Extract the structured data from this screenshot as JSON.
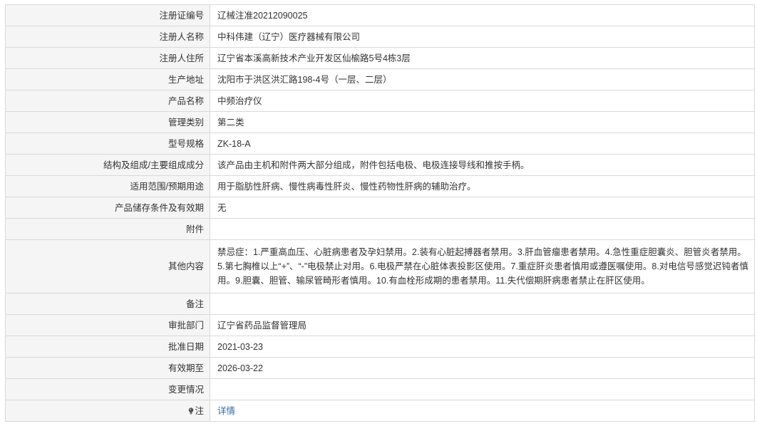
{
  "rows": [
    {
      "label": "注册证编号",
      "value": "辽械注准20212090025"
    },
    {
      "label": "注册人名称",
      "value": "中科伟建（辽宁）医疗器械有限公司"
    },
    {
      "label": "注册人住所",
      "value": "辽宁省本溪高新技术产业开发区仙榆路5号4栋3层"
    },
    {
      "label": "生产地址",
      "value": "沈阳市于洪区洪汇路198-4号（一层、二层）"
    },
    {
      "label": "产品名称",
      "value": "中频治疗仪"
    },
    {
      "label": "管理类别",
      "value": "第二类"
    },
    {
      "label": "型号规格",
      "value": "ZK-18-A"
    },
    {
      "label": "结构及组成/主要组成成分",
      "value": "该产品由主机和附件两大部分组成，附件包括电极、电极连接导线和推按手柄。"
    },
    {
      "label": "适用范围/预期用途",
      "value": "用于脂肪性肝病、慢性病毒性肝炎、慢性药物性肝病的辅助治疗。"
    },
    {
      "label": "产品储存条件及有效期",
      "value": "无"
    },
    {
      "label": "附件",
      "value": ""
    },
    {
      "label": "其他内容",
      "value": "禁忌症：1.严重高血压、心脏病患者及孕妇禁用。2.装有心脏起搏器者禁用。3.肝血管瘤患者禁用。4.急性重症胆囊炎、胆管炎者禁用。5.第七胸椎以上“+”、“-”电极禁止对用。6.电极严禁在心脏体表投影区使用。7.重症肝炎患者慎用或遵医嘱使用。8.对电信号感觉迟钝者慎用。9.胆囊、胆管、输尿管畸形者慎用。10.有血栓形成期的患者禁用。11.失代偿期肝病患者禁止在肝区使用。"
    },
    {
      "label": "备注",
      "value": ""
    },
    {
      "label": "审批部门",
      "value": "辽宁省药品监督管理局"
    },
    {
      "label": "批准日期",
      "value": "2021-03-23"
    },
    {
      "label": "有效期至",
      "value": "2026-03-22"
    },
    {
      "label": "变更情况",
      "value": ""
    }
  ],
  "note": {
    "label": "注",
    "icon": "lightbulb-icon",
    "link_text": "详情"
  }
}
